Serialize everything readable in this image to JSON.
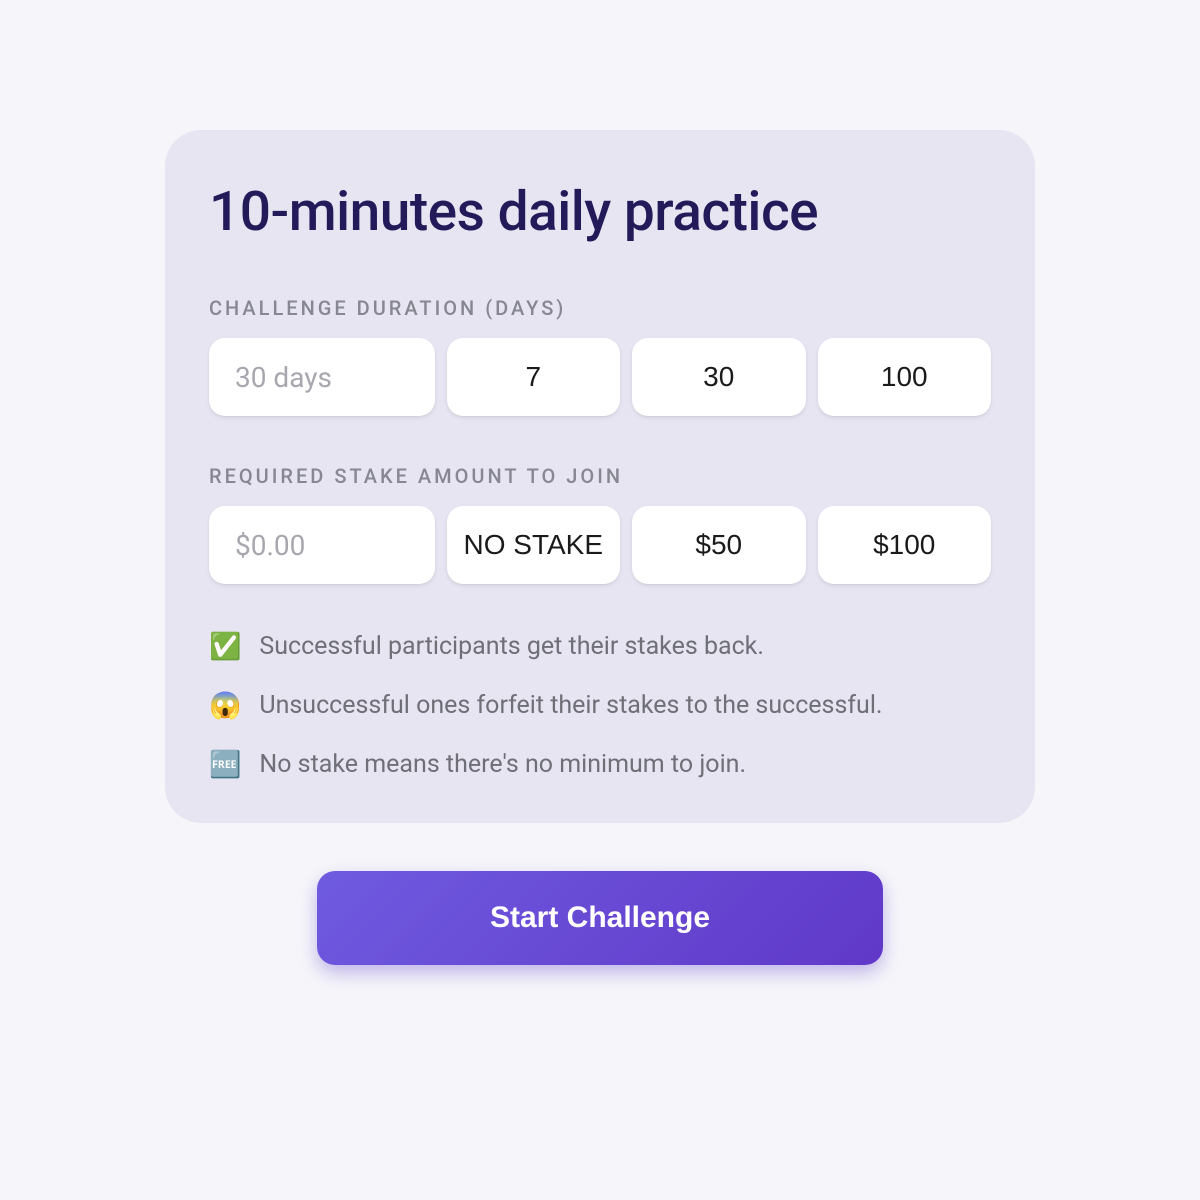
{
  "title": "10-minutes daily practice",
  "duration": {
    "label": "CHALLENGE DURATION (DAYS)",
    "placeholder": "30 days",
    "options": [
      "7",
      "30",
      "100"
    ]
  },
  "stake": {
    "label": "REQUIRED STAKE AMOUNT TO JOIN",
    "placeholder": "$0.00",
    "options": [
      "NO STAKE",
      "$50",
      "$100"
    ]
  },
  "info": [
    {
      "emoji": "✅",
      "text": "Successful participants get their stakes back."
    },
    {
      "emoji": "😱",
      "text": "Unsuccessful ones forfeit their stakes to the successful."
    },
    {
      "emoji": "🆓",
      "text": "No stake means there's no minimum to join."
    }
  ],
  "cta": "Start Challenge"
}
